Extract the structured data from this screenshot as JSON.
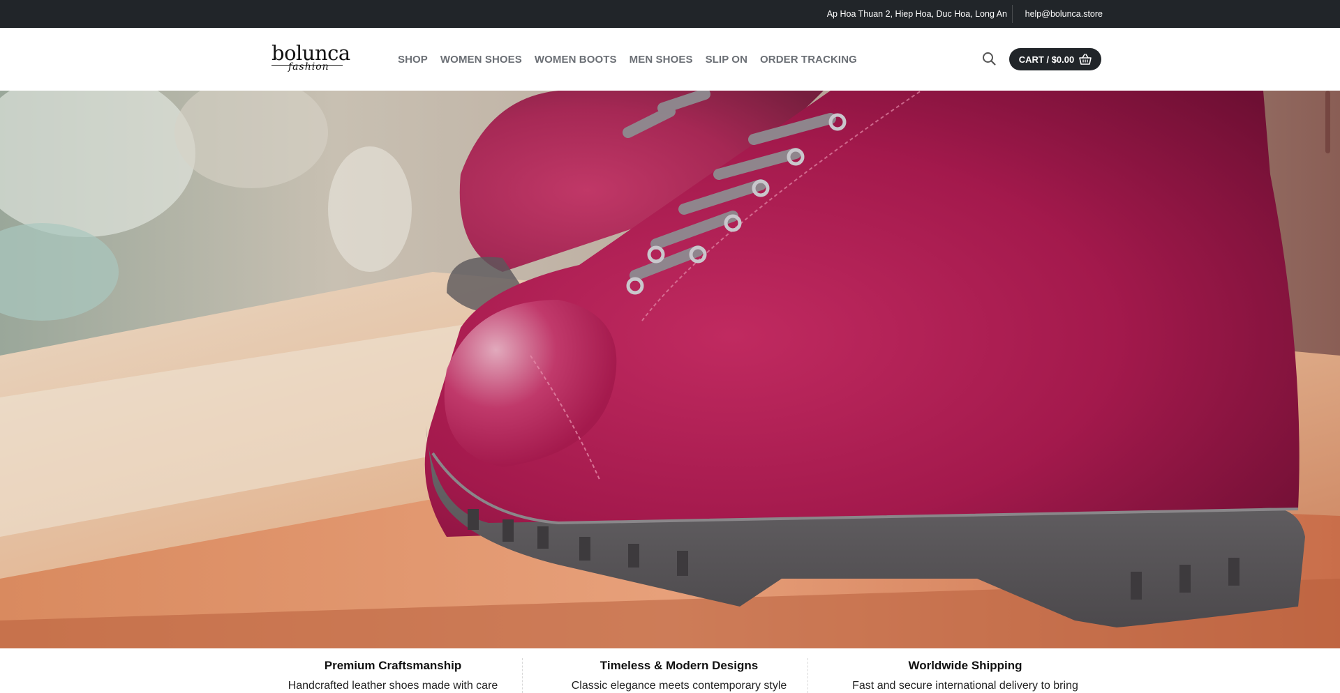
{
  "topbar": {
    "address": "Ap Hoa Thuan 2, Hiep Hoa, Duc Hoa, Long An",
    "email": "help@bolunca.store"
  },
  "header": {
    "logo_text": "bolunca",
    "logo_script": "fashion",
    "nav": [
      {
        "label": "SHOP"
      },
      {
        "label": "WOMEN SHOES"
      },
      {
        "label": "WOMEN BOOTS"
      },
      {
        "label": "MEN SHOES"
      },
      {
        "label": "SLIP ON"
      },
      {
        "label": "ORDER TRACKING"
      }
    ],
    "search_icon": "search-icon",
    "cart_label": "CART / $0.00",
    "cart_icon": "basket-icon"
  },
  "features": [
    {
      "title": "Premium Craftsmanship",
      "text": "Handcrafted leather shoes made with care"
    },
    {
      "title": "Timeless & Modern Designs",
      "text": "Classic elegance meets contemporary style"
    },
    {
      "title": "Worldwide Shipping",
      "text": "Fast and secure international delivery to bring"
    }
  ],
  "colors": {
    "topbar_bg": "#212529",
    "nav_text": "#6b6f75",
    "cart_bg": "#212529",
    "boot": "#a3194c"
  }
}
